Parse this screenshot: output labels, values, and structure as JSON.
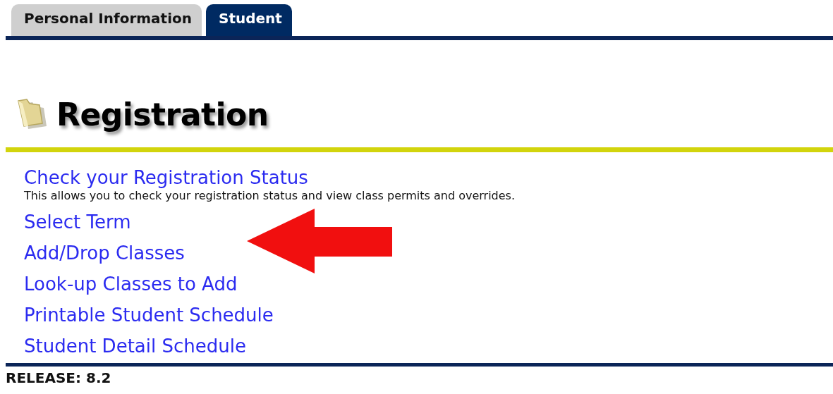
{
  "tabs": [
    {
      "label": "Personal Information",
      "selected": false
    },
    {
      "label": "Student",
      "selected": true
    }
  ],
  "page_title": "Registration",
  "links": [
    {
      "label": "Check your Registration Status",
      "description": "This allows you to check your registration status and view class permits and overrides."
    },
    {
      "label": "Select Term"
    },
    {
      "label": "Add/Drop Classes"
    },
    {
      "label": "Look-up Classes to Add"
    },
    {
      "label": "Printable Student Schedule"
    },
    {
      "label": "Student Detail Schedule"
    }
  ],
  "release": "RELEASE: 8.2"
}
